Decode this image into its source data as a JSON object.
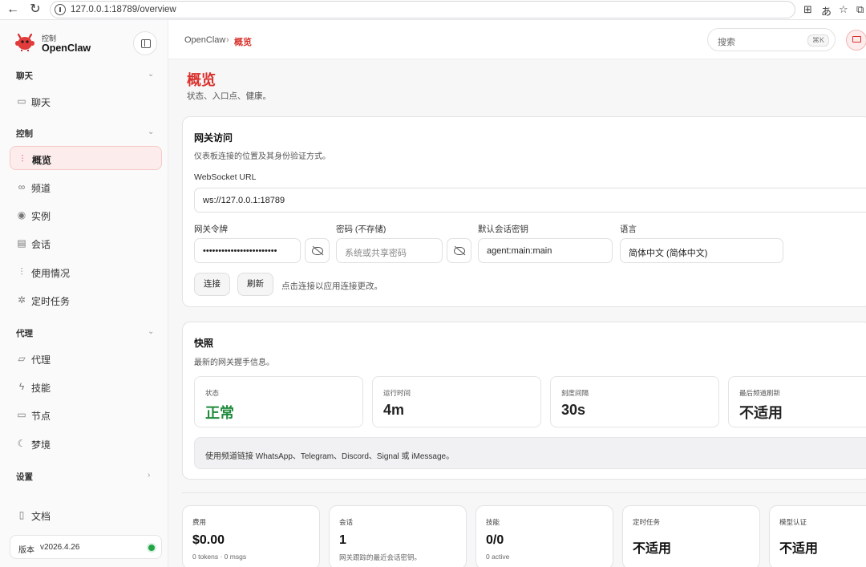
{
  "browser": {
    "url": "127.0.0.1:18789/overview"
  },
  "sidebar": {
    "brand_small": "控制",
    "brand_name": "OpenClaw",
    "sections": [
      {
        "label": "聊天",
        "items": [
          {
            "label": "聊天",
            "icon": "message-icon"
          }
        ]
      },
      {
        "label": "控制",
        "items": [
          {
            "label": "概览",
            "icon": "bar-chart-icon",
            "active": true
          },
          {
            "label": "频道",
            "icon": "link-icon"
          },
          {
            "label": "实例",
            "icon": "broadcast-icon"
          },
          {
            "label": "会话",
            "icon": "document-icon"
          },
          {
            "label": "使用情况",
            "icon": "bar-chart-icon"
          },
          {
            "label": "定时任务",
            "icon": "loader-icon"
          }
        ]
      },
      {
        "label": "代理",
        "items": [
          {
            "label": "代理",
            "icon": "folder-icon"
          },
          {
            "label": "技能",
            "icon": "lightning-icon"
          },
          {
            "label": "节点",
            "icon": "monitor-icon"
          },
          {
            "label": "梦境",
            "icon": "moon-icon"
          }
        ]
      },
      {
        "label": "设置",
        "items": []
      }
    ],
    "docs_label": "文档",
    "version_label": "版本",
    "version_value": "v2026.4.26",
    "status_color": "#22a447"
  },
  "topbar": {
    "crumb_root": "OpenClaw",
    "crumb_sep": "›",
    "crumb_current": "概览",
    "search_placeholder": "搜索",
    "search_shortcut": "⌘K"
  },
  "page": {
    "title": "概览",
    "subtitle": "状态、入口点、健康。"
  },
  "gateway": {
    "title": "网关访问",
    "subtitle": "仪表板连接的位置及其身份验证方式。",
    "ws_label": "WebSocket URL",
    "ws_value": "ws://127.0.0.1:18789",
    "token_label": "网关令牌",
    "token_value": "••••••••••••••••••••••••",
    "password_label": "密码 (不存储)",
    "password_placeholder": "系统或共享密码",
    "session_label": "默认会话密钥",
    "session_value": "agent:main:main",
    "lang_label": "语言",
    "lang_value": "简体中文 (简体中文)",
    "connect_label": "连接",
    "refresh_label": "刷新",
    "hint": "点击连接以应用连接更改。"
  },
  "snapshot": {
    "title": "快照",
    "subtitle": "最新的网关握手信息。",
    "stats": [
      {
        "label": "状态",
        "value": "正常"
      },
      {
        "label": "运行时间",
        "value": "4m"
      },
      {
        "label": "刻度间隔",
        "value": "30s"
      },
      {
        "label": "最后频道刷新",
        "value": "不适用"
      }
    ],
    "notice": "使用频道链接 WhatsApp、Telegram、Discord、Signal 或 iMessage。"
  },
  "metrics": [
    {
      "label": "费用",
      "value": "$0.00",
      "sub": "0 tokens · 0 msgs"
    },
    {
      "label": "会话",
      "value": "1",
      "sub": "网关跟踪的最近会话密钥。"
    },
    {
      "label": "技能",
      "value": "0/0",
      "sub": "0 active"
    },
    {
      "label": "定时任务",
      "value": "不适用",
      "sub": ""
    },
    {
      "label": "模型认证",
      "value": "不适用",
      "sub": ""
    }
  ]
}
